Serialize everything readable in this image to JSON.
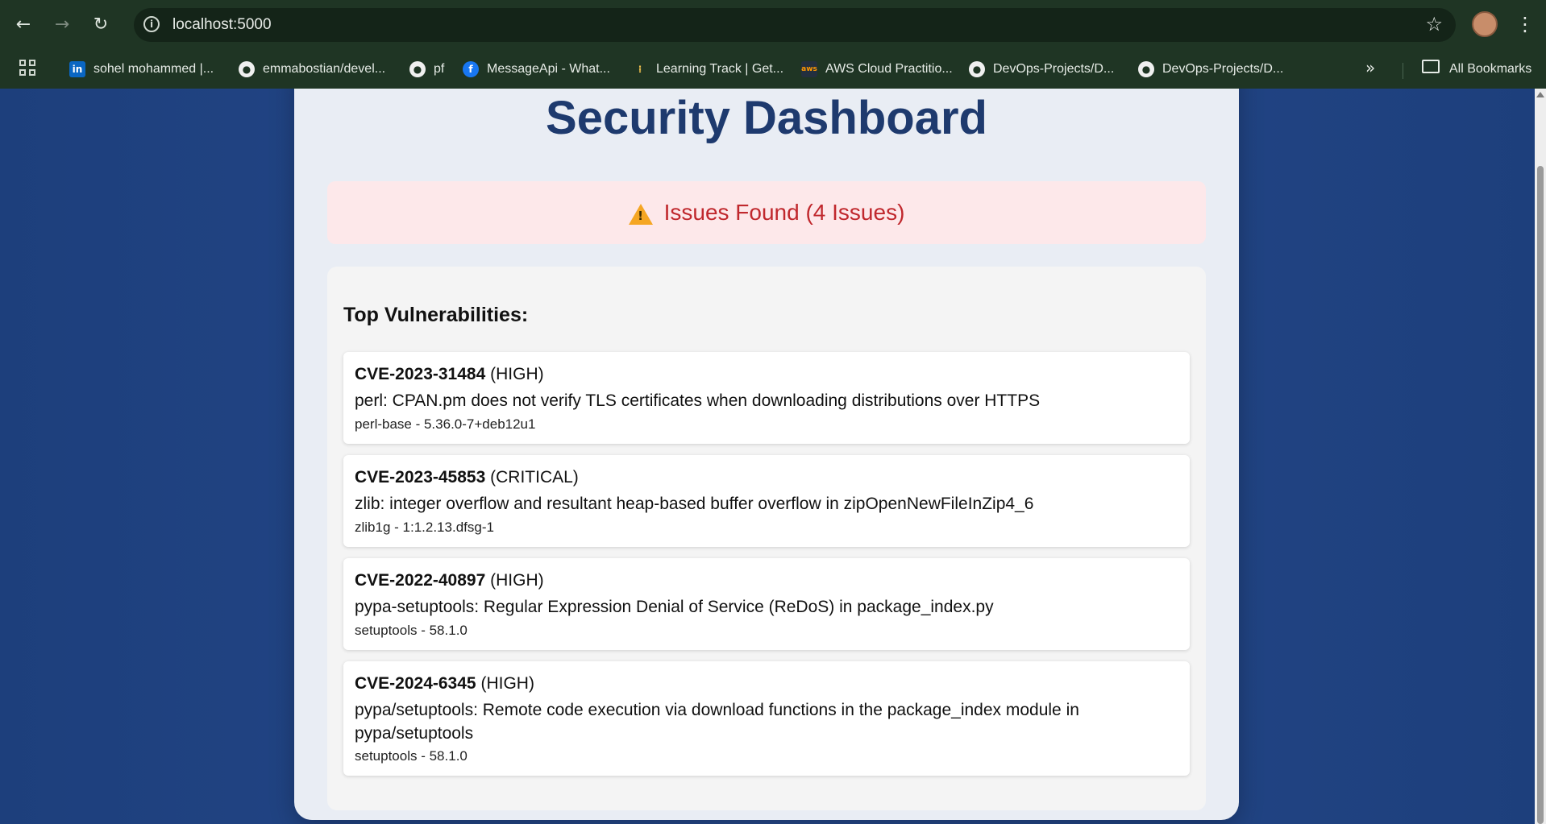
{
  "browser": {
    "url": "localhost:5000",
    "bookmarks": [
      {
        "label": "sohel mohammed |...",
        "icon": "linkedin-icon"
      },
      {
        "label": "emmabostian/devel...",
        "icon": "github-icon"
      },
      {
        "label": "pf",
        "icon": "github-icon"
      },
      {
        "label": "MessageApi - What...",
        "icon": "facebook-icon"
      },
      {
        "label": "Learning Track | Get...",
        "icon": "learning-track-icon"
      },
      {
        "label": "AWS Cloud Practitio...",
        "icon": "aws-icon"
      },
      {
        "label": "DevOps-Projects/D...",
        "icon": "github-icon"
      },
      {
        "label": "DevOps-Projects/D...",
        "icon": "github-icon"
      }
    ],
    "all_bookmarks_label": "All Bookmarks",
    "more_label": "»"
  },
  "page": {
    "title": "Security Dashboard",
    "alert": {
      "text": "Issues Found (4 Issues)",
      "color": "#c0282d"
    },
    "section_title": "Top Vulnerabilities:",
    "vulnerabilities": [
      {
        "id": "CVE-2023-31484",
        "severity": "(HIGH)",
        "description": "perl: CPAN.pm does not verify TLS certificates when downloading distributions over HTTPS",
        "package": "perl-base - 5.36.0-7+deb12u1"
      },
      {
        "id": "CVE-2023-45853",
        "severity": "(CRITICAL)",
        "description": "zlib: integer overflow and resultant heap-based buffer overflow in zipOpenNewFileInZip4_6",
        "package": "zlib1g - 1:1.2.13.dfsg-1"
      },
      {
        "id": "CVE-2022-40897",
        "severity": "(HIGH)",
        "description": "pypa-setuptools: Regular Expression Denial of Service (ReDoS) in package_index.py",
        "package": "setuptools - 58.1.0"
      },
      {
        "id": "CVE-2024-6345",
        "severity": "(HIGH)",
        "description": "pypa/setuptools: Remote code execution via download functions in the package_index module in pypa/setuptools",
        "package": "setuptools - 58.1.0"
      }
    ]
  },
  "colors": {
    "title": "#1e3a6e",
    "background": "#1d3f7c",
    "alert_bg": "#fde8ea"
  }
}
